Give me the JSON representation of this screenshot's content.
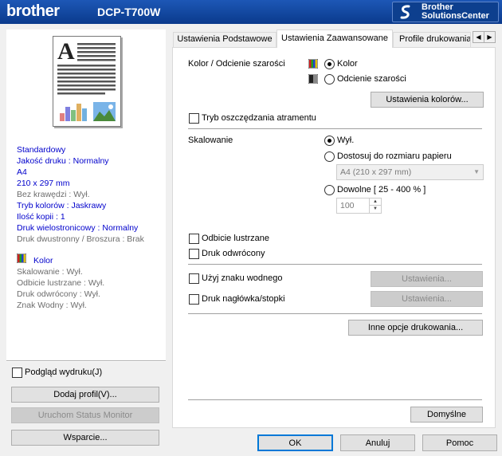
{
  "header": {
    "brand": "brother",
    "model": "DCP-T700W",
    "solutions_line1": "Brother",
    "solutions_line2": "SolutionsCenter"
  },
  "summary": {
    "lines": [
      {
        "text": "Standardowy",
        "style": "blue"
      },
      {
        "text": "Jakość druku : Normalny",
        "style": "blue"
      },
      {
        "text": "A4",
        "style": "blue"
      },
      {
        "text": "210 x 297 mm",
        "style": "blue"
      },
      {
        "text": "Bez krawędzi : Wył.",
        "style": "gray"
      },
      {
        "text": "Tryb kolorów : Jaskrawy",
        "style": "blue"
      },
      {
        "text": "Ilość kopii : 1",
        "style": "blue"
      },
      {
        "text": "Druk wielostronicowy : Normalny",
        "style": "blue"
      },
      {
        "text": "Druk dwustronny / Broszura : Brak",
        "style": "gray"
      }
    ],
    "color_label": "Kolor",
    "lines2": [
      "Skalowanie : Wył.",
      "Odbicie lustrzane : Wył.",
      "Druk odwrócony : Wył.",
      "Znak Wodny : Wył."
    ]
  },
  "left": {
    "preview_label": "Podgląd wydruku(J)",
    "add_profile": "Dodaj profil(V)...",
    "status_monitor": "Uruchom Status Monitor",
    "support": "Wsparcie..."
  },
  "tabs": [
    {
      "label": "Ustawienia Podstawowe",
      "active": false
    },
    {
      "label": "Ustawienia Zaawansowane",
      "active": true
    },
    {
      "label": "Profile drukowania",
      "active": false
    }
  ],
  "advanced": {
    "color_label": "Kolor / Odcienie szarości",
    "color_options": [
      "Kolor",
      "Odcienie szarości"
    ],
    "color_selected": "Kolor",
    "color_settings": "Ustawienia kolorów...",
    "ink_save": "Tryb oszczędzania atramentu",
    "scaling_label": "Skalowanie",
    "scaling_off": "Wył.",
    "scaling_fit": "Dostosuj do rozmiaru papieru",
    "paper_size": "A4 (210 x 297 mm)",
    "scaling_custom": "Dowolne [ 25 - 400 % ]",
    "scaling_value": "100",
    "mirror": "Odbicie lustrzane",
    "reverse": "Druk odwrócony",
    "watermark": "Użyj znaku wodnego",
    "watermark_settings": "Ustawienia...",
    "header_footer": "Druk nagłówka/stopki",
    "header_footer_settings": "Ustawienia...",
    "other_options": "Inne opcje drukowania...",
    "defaults": "Domyślne"
  },
  "footer": {
    "ok": "OK",
    "cancel": "Anuluj",
    "help": "Pomoc"
  },
  "colors": {
    "header_blue": "#0a3a8c",
    "summary_blue": "#0000cc",
    "focus_blue": "#0078d7"
  }
}
